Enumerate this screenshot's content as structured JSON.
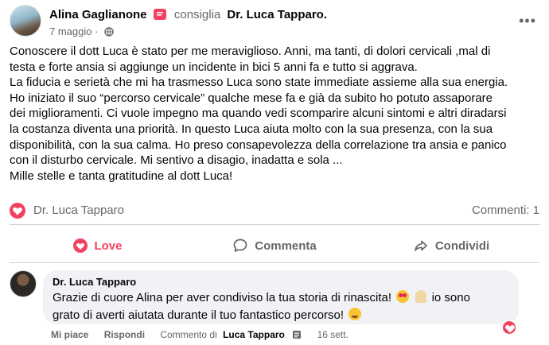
{
  "post": {
    "author": "Alina Gaglianone",
    "recommend_verb": "consiglia",
    "target": "Dr. Luca Tapparo.",
    "date": "7 maggio",
    "more_label": "•••",
    "body_lines": [
      "Conoscere il dott Luca è stato per me meraviglioso. Anni, ma tanti, di dolori cervicali ,mal di",
      "testa e forte ansia si aggiunge un incidente in bici 5 anni fa e tutto si aggrava.",
      "La fiducia e serietà che mi ha trasmesso Luca sono state immediate assieme alla sua energia.",
      "Ho iniziato il suo “percorso cervicale” qualche mese fa e già da subito ho potuto assaporare",
      "dei miglioramenti. Ci vuole impegno ma quando vedi scomparire alcuni sintomi e altri diradarsi",
      "la costanza diventa una priorità. In questo Luca aiuta molto con la sua presenza, con la sua",
      "disponibilità, con la sua calma. Ho preso consapevolezza della correlazione tra ansia e panico",
      "con il disturbo cervicale. Mi sentivo a disagio, inadatta e sola ...",
      "Mille stelle e tanta gratitudine al dott Luca!"
    ]
  },
  "reactions": {
    "name": "Dr. Luca Tapparo",
    "comments": "Commenti: 1"
  },
  "actions": {
    "love": "Love",
    "comment": "Commenta",
    "share": "Condividi"
  },
  "comment": {
    "author": "Dr. Luca Tapparo",
    "line1_a": "Grazie di cuore Alina per aver condiviso la tua storia di rinascita!",
    "line1_b": "io sono",
    "line2": "grato di averti aiutata durante il tuo fantastico percorso!",
    "like": "Mi piace",
    "reply": "Rispondi",
    "by_label": "Commento di",
    "by_name": "Luca Tapparo",
    "time": "16 sett."
  },
  "colors": {
    "love": "#f3425f",
    "muted": "#65676b",
    "bubble": "#f0f2f5"
  }
}
